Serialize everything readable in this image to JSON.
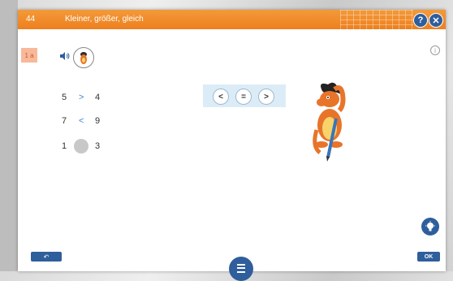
{
  "header": {
    "number": "44",
    "title": "Kleiner, größer, gleich",
    "help_symbol": "?",
    "close_symbol": "✕"
  },
  "task": {
    "badge": "1 a",
    "info_symbol": "i"
  },
  "comparisons": [
    {
      "left": "5",
      "op": ">",
      "right": "4"
    },
    {
      "left": "7",
      "op": "<",
      "right": "9"
    },
    {
      "left": "1",
      "op": "",
      "right": "3"
    }
  ],
  "symbols": [
    "<",
    "=",
    ">"
  ],
  "footer": {
    "undo_label": "↶",
    "ok_label": "OK"
  },
  "colors": {
    "accent_orange": "#ee7f1d",
    "button_blue": "#2f5e9c",
    "symbol_panel": "#dcecf7",
    "operator_blue": "#3b86d0"
  },
  "icons": [
    "speaker-icon",
    "character-avatar-icon",
    "info-icon",
    "hint-bulb-icon",
    "menu-icon"
  ]
}
